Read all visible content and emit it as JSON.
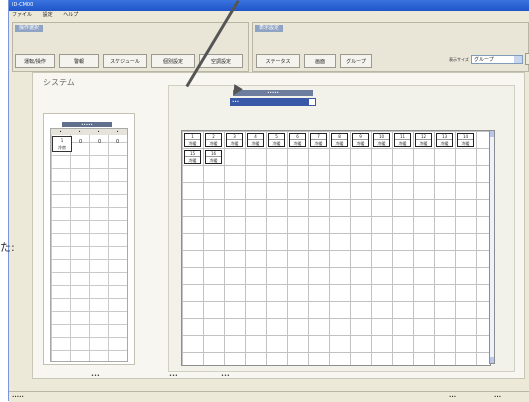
{
  "window": {
    "title": "ID-CM00",
    "menu": [
      "ファイル",
      "設定",
      "ヘルプ"
    ]
  },
  "sections": {
    "left_title": "操作選択",
    "right_title": "表示設定"
  },
  "toolbar": {
    "buttons": [
      "運転/操作",
      "警報",
      "スケジュール",
      "個別設定",
      "空調設定"
    ],
    "buttons2": [
      "ステータス",
      "画面",
      "グループ"
    ],
    "combo_label": "表示サイズ",
    "combo_value": "グループ"
  },
  "main": {
    "system_label": "システム"
  },
  "left_panel": {
    "header": "•••••",
    "columns": [
      "•",
      "•",
      "•",
      "•"
    ],
    "cell_top": "1",
    "cell_bottom": "冷房",
    "values": [
      "0",
      "0",
      "0"
    ]
  },
  "right_panel": {
    "header": "•••••",
    "select_value": "•••"
  },
  "units": [
    {
      "top": "1",
      "bottom": "冷暖"
    },
    {
      "top": "2",
      "bottom": "冷暖"
    },
    {
      "top": "3",
      "bottom": "冷暖"
    },
    {
      "top": "4",
      "bottom": "冷暖"
    },
    {
      "top": "5",
      "bottom": "冷暖"
    },
    {
      "top": "6",
      "bottom": "冷暖"
    },
    {
      "top": "7",
      "bottom": "冷暖"
    },
    {
      "top": "8",
      "bottom": "冷暖"
    },
    {
      "top": "9",
      "bottom": "冷暖"
    },
    {
      "top": "10",
      "bottom": "冷暖"
    },
    {
      "top": "11",
      "bottom": "冷暖"
    },
    {
      "top": "12",
      "bottom": "冷暖"
    },
    {
      "top": "13",
      "bottom": "冷暖"
    },
    {
      "top": "14",
      "bottom": "冷暖"
    },
    {
      "top": "15",
      "bottom": "冷暖"
    },
    {
      "top": "16",
      "bottom": "冷暖"
    }
  ],
  "legend": [
    "•••",
    "•••",
    "•••"
  ],
  "status_bar": {
    "left": "•••••",
    "right1": "•••",
    "right2": "•••"
  },
  "edge_text": "た:"
}
